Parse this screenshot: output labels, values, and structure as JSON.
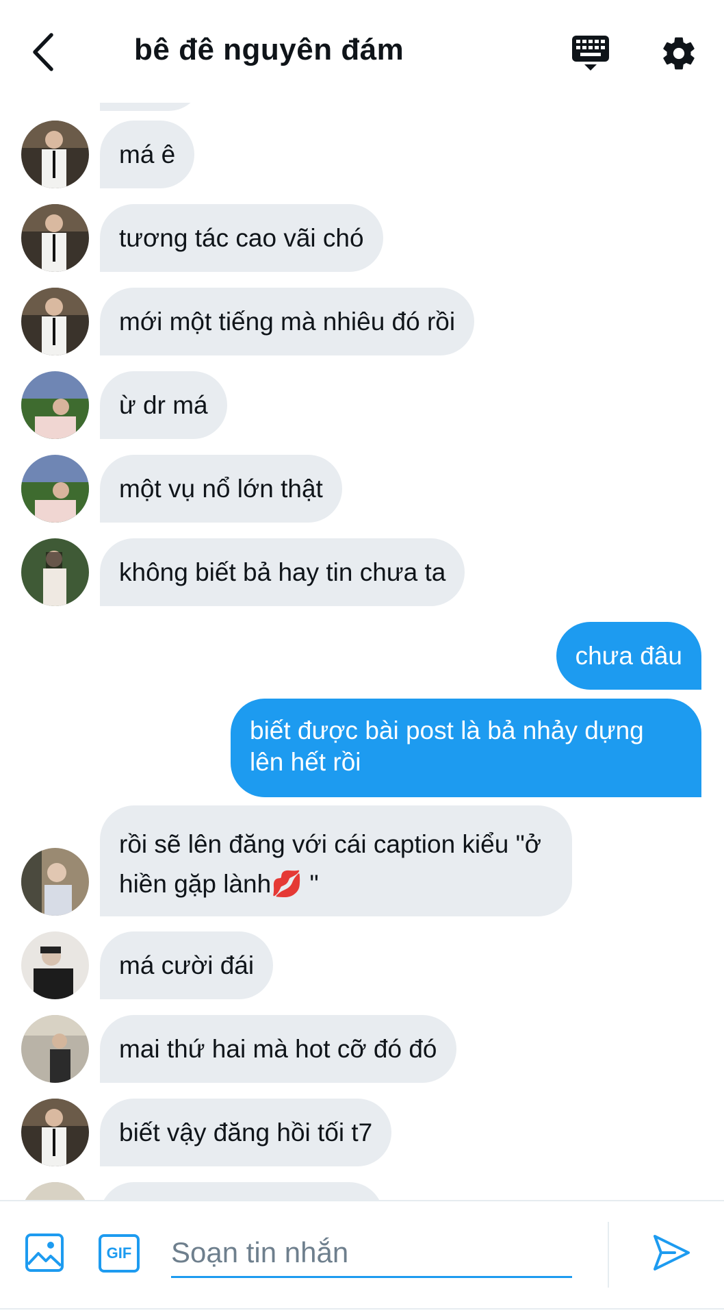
{
  "header": {
    "title": "bê đê nguyên đám",
    "back_icon": "chevron-left-icon",
    "keyboard_icon": "keyboard-icon",
    "settings_icon": "gear-icon"
  },
  "messages": [
    {
      "text": "má ê",
      "from": "other",
      "avatar": "avatar-a"
    },
    {
      "text": "tương tác cao vãi chó",
      "from": "other",
      "avatar": "avatar-a"
    },
    {
      "text": "mới một tiếng mà nhiêu đó rồi",
      "from": "other",
      "avatar": "avatar-a"
    },
    {
      "text": "ừ dr má",
      "from": "other",
      "avatar": "avatar-b"
    },
    {
      "text": "một vụ nổ lớn thật",
      "from": "other",
      "avatar": "avatar-b"
    },
    {
      "text": "không biết bả hay tin chưa ta",
      "from": "other",
      "avatar": "avatar-c"
    },
    {
      "text": "chưa đâu",
      "from": "me"
    },
    {
      "text": "biết được bài post là bả nhảy dựng lên hết rồi",
      "from": "me"
    },
    {
      "text": "rồi sẽ lên đăng với cái caption kiểu \"ở hiền gặp lành💋 \"",
      "from": "other",
      "avatar": "avatar-d"
    },
    {
      "text": "má cười đái",
      "from": "other",
      "avatar": "avatar-e"
    },
    {
      "text": "mai thứ hai mà hot cỡ đó đó",
      "from": "other",
      "avatar": "avatar-f"
    },
    {
      "text": "biết vậy đăng hồi tối t7",
      "from": "other",
      "avatar": "avatar-a"
    }
  ],
  "composer": {
    "placeholder": "Soạn tin nhắn",
    "gif_label": "GIF",
    "image_icon": "image-icon",
    "send_icon": "send-icon"
  },
  "colors": {
    "accent": "#1d9bf0",
    "bubble_other": "#e8ecf0",
    "text": "#0f1419",
    "placeholder": "#6e7f8d"
  }
}
